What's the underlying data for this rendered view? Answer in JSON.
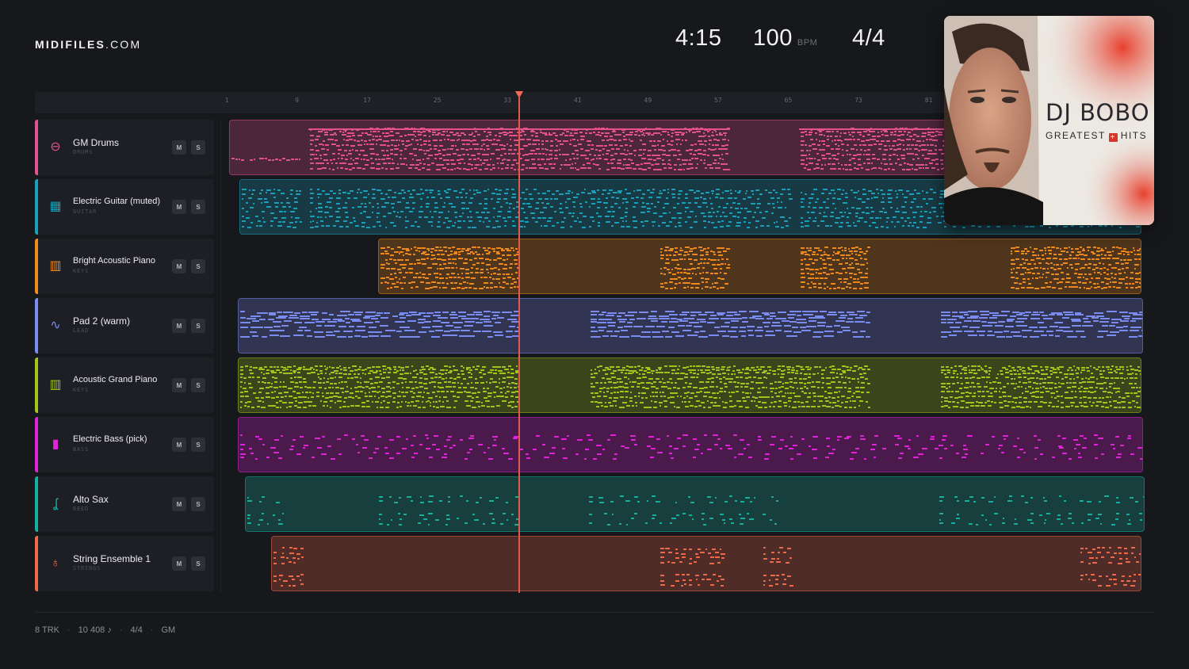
{
  "brand": {
    "bold": "MIDIFILES",
    "light": ".COM"
  },
  "stats": {
    "duration": "4:15",
    "tempo": "100",
    "tempo_unit": "BPM",
    "meter": "4/4"
  },
  "ruler": {
    "ticks": [
      "1",
      "9",
      "17",
      "25",
      "33",
      "41",
      "49",
      "57",
      "65",
      "73",
      "81"
    ]
  },
  "playhead_bar": 33,
  "album": {
    "artist": "DJ BOBO",
    "subtitle_left": "GREATEST",
    "subtitle_cross": "+",
    "subtitle_right": "HITS"
  },
  "tracks": [
    {
      "name": "GM Drums",
      "category": "DRUMS",
      "color": "#e4528e",
      "icon": "drum-icon",
      "glyph": "⊖",
      "mute": "M",
      "solo": "S"
    },
    {
      "name": "Electric Guitar (muted)",
      "category": "GUITAR",
      "color": "#1aa0b8",
      "icon": "guitar-grid-icon",
      "glyph": "▦",
      "mute": "M",
      "solo": "S"
    },
    {
      "name": "Bright Acoustic Piano",
      "category": "KEYS",
      "color": "#f08a1c",
      "icon": "piano-keys-icon",
      "glyph": "▥",
      "mute": "M",
      "solo": "S"
    },
    {
      "name": "Pad 2 (warm)",
      "category": "LEAD",
      "color": "#7a8cf0",
      "icon": "waveform-icon",
      "glyph": "∿",
      "mute": "M",
      "solo": "S"
    },
    {
      "name": "Acoustic Grand Piano",
      "category": "KEYS",
      "color": "#a6c41a",
      "icon": "piano-keys-icon",
      "glyph": "▥",
      "mute": "M",
      "solo": "S"
    },
    {
      "name": "Electric Bass (pick)",
      "category": "BASS",
      "color": "#e024d8",
      "icon": "bass-icon",
      "glyph": "▮",
      "mute": "M",
      "solo": "S"
    },
    {
      "name": "Alto Sax",
      "category": "REED",
      "color": "#17b0a0",
      "icon": "sax-icon",
      "glyph": "ʆ",
      "mute": "M",
      "solo": "S"
    },
    {
      "name": "String Ensemble 1",
      "category": "STRINGS",
      "color": "#f06a4a",
      "icon": "violin-icon",
      "glyph": "♁",
      "mute": "M",
      "solo": "S"
    }
  ],
  "footer": {
    "tracks": "8 TRK",
    "notes": "10 408 ♪",
    "meter": "4/4",
    "standard": "GM"
  }
}
